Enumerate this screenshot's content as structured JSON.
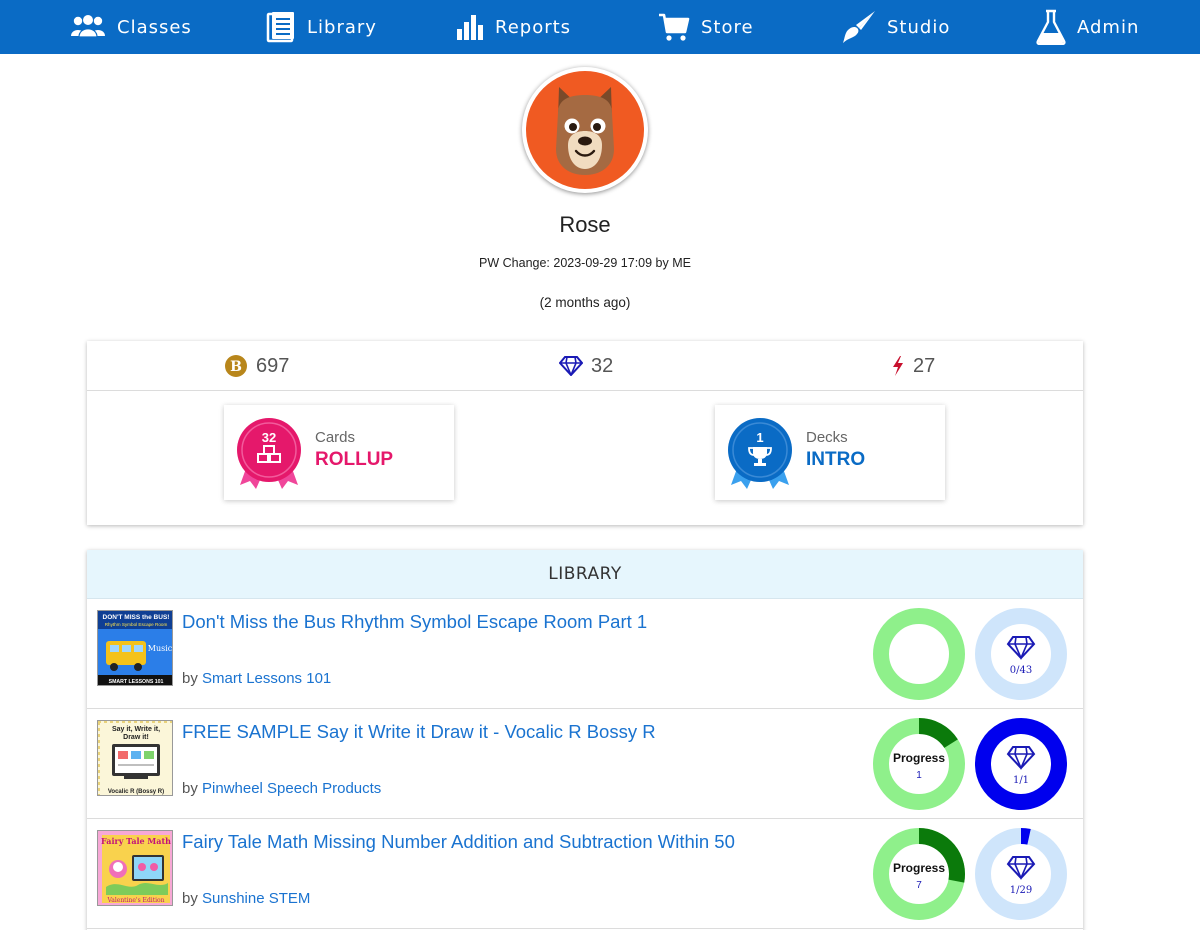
{
  "nav": {
    "items": [
      {
        "label": "Classes",
        "icon": "users-icon"
      },
      {
        "label": "Library",
        "icon": "book-icon"
      },
      {
        "label": "Reports",
        "icon": "bar-chart-icon"
      },
      {
        "label": "Store",
        "icon": "cart-icon"
      },
      {
        "label": "Studio",
        "icon": "paintbrush-icon"
      },
      {
        "label": "Admin",
        "icon": "flask-icon"
      }
    ]
  },
  "profile": {
    "name": "Rose",
    "pw_change": "PW Change: 2023-09-29 17:09 by ME",
    "ago": "(2 months ago)",
    "avatar_icon": "dog-avatar-icon"
  },
  "stats": {
    "coins": "697",
    "gems": "32",
    "energy": "27",
    "coin_letter": "B"
  },
  "badges": [
    {
      "number": "32",
      "label": "Cards",
      "value": "ROLLUP",
      "color": "#e5186b",
      "icon": "cubes-icon"
    },
    {
      "number": "1",
      "label": "Decks",
      "value": "INTRO",
      "color": "#0a6bc5",
      "icon": "trophy-icon"
    }
  ],
  "library": {
    "heading": "LIBRARY",
    "items": [
      {
        "title": "Don't Miss the Bus Rhythm Symbol Escape Room Part 1",
        "by": "by",
        "author": "Smart Lessons 101",
        "thumb_text": [
          "DON'T MISS the BUS!",
          "Rhythm Symbol Escape Room",
          "Music",
          "SMART LESSONS 101"
        ],
        "progress": {
          "label": "",
          "value": "",
          "fraction": 0
        },
        "gems": {
          "text": "0/43",
          "fraction": 0
        }
      },
      {
        "title": "FREE SAMPLE Say it Write it Draw it - Vocalic R Bossy R",
        "by": "by",
        "author": "Pinwheel Speech Products",
        "thumb_text": [
          "Say it, Write it,",
          "Draw it!",
          "Vocalic R (Bossy R)"
        ],
        "progress": {
          "label": "Progress",
          "value": "1",
          "fraction": 0.16
        },
        "gems": {
          "text": "1/1",
          "fraction": 1
        }
      },
      {
        "title": "Fairy Tale Math Missing Number Addition and Subtraction Within 50",
        "by": "by",
        "author": "Sunshine STEM",
        "thumb_text": [
          "Fairy Tale Math",
          "Valentine's Edition"
        ],
        "progress": {
          "label": "Progress",
          "value": "7",
          "fraction": 0.28
        },
        "gems": {
          "text": "1/29",
          "fraction": 0.034
        }
      }
    ]
  },
  "colors": {
    "nav": "#0a6bc5",
    "link": "#1a73d0",
    "progress_track": "#8ff08b",
    "progress_fill": "#0b7a0b",
    "gem_track": "#cfe5fb",
    "gem_fill": "#0000ee",
    "pink": "#e5186b",
    "coin": "#b8861b",
    "energy": "#c8102e"
  }
}
